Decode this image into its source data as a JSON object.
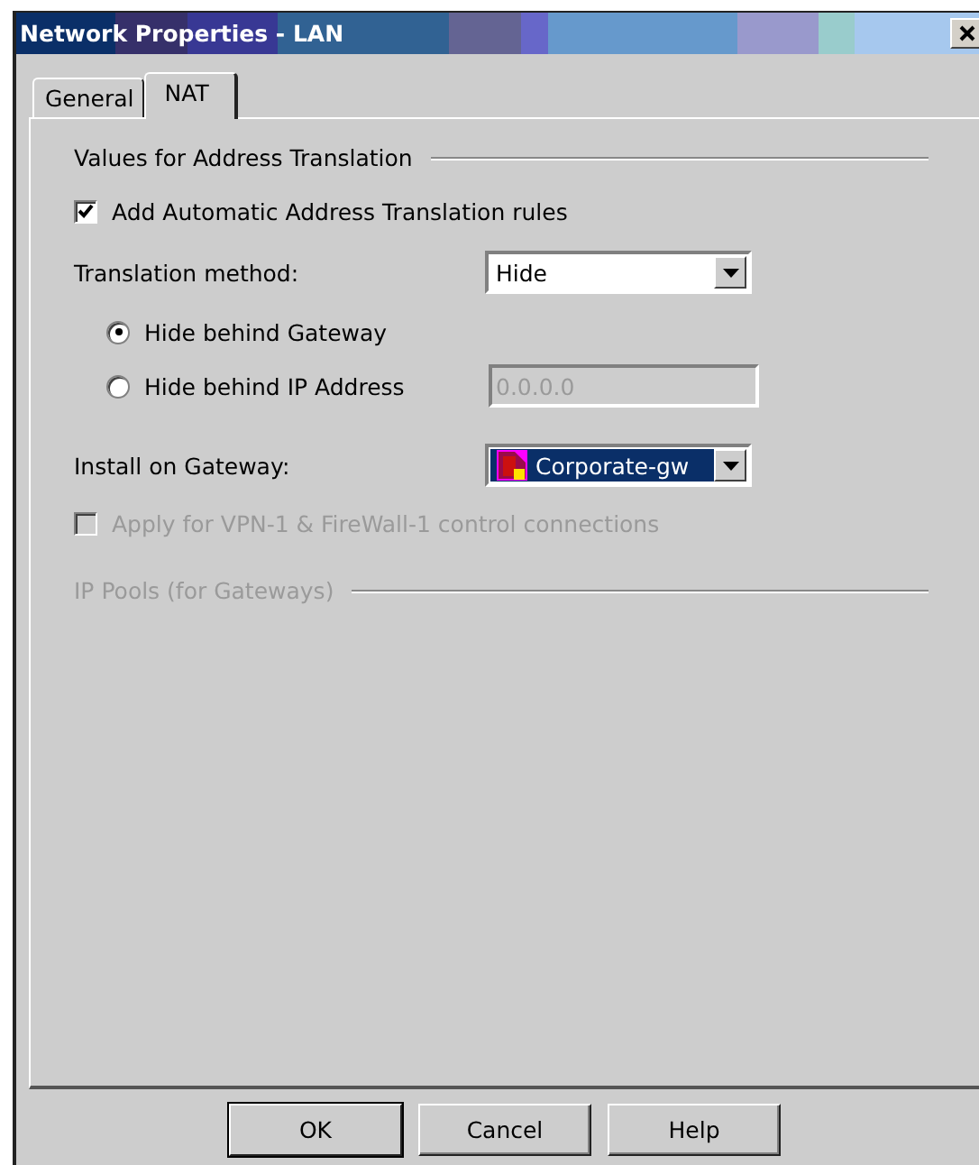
{
  "window": {
    "title": "Network Properties - LAN"
  },
  "tabs": [
    {
      "label": "General",
      "selected": false
    },
    {
      "label": "NAT",
      "selected": true
    }
  ],
  "section": {
    "title": "Values for Address Translation"
  },
  "auto_rules": {
    "label": "Add Automatic Address Translation rules",
    "checked": true,
    "disabled": false
  },
  "translation_method": {
    "label": "Translation method:",
    "value": "Hide"
  },
  "hide_options": [
    {
      "label": "Hide behind Gateway",
      "selected": true
    },
    {
      "label": "Hide behind IP Address",
      "selected": false,
      "field": {
        "value": "0.0.0.0",
        "disabled": true
      }
    }
  ],
  "install_on": {
    "label": "Install on Gateway:",
    "value": "Corporate-gw"
  },
  "apply_control": {
    "label": "Apply for VPN-1 & FireWall-1 control connections",
    "checked": false,
    "disabled": true
  },
  "ip_pools": {
    "title": "IP Pools (for Gateways)",
    "disabled": true
  },
  "buttons": [
    {
      "label": "OK",
      "default": true
    },
    {
      "label": "Cancel",
      "default": false
    },
    {
      "label": "Help",
      "default": false
    }
  ]
}
